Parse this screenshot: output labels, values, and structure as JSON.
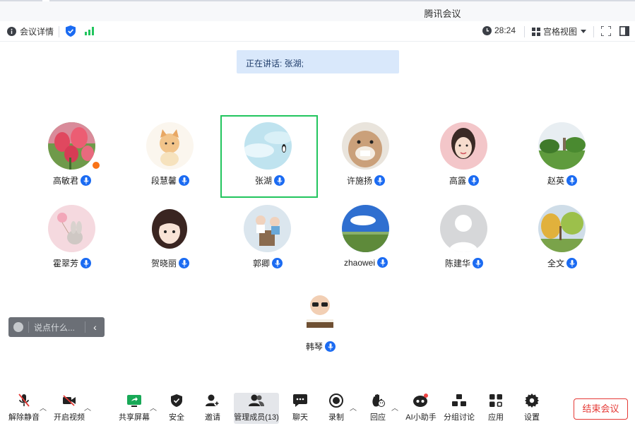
{
  "window": {
    "title": "腾讯会议"
  },
  "toolbar": {
    "meeting_details": "会议详情",
    "timer": "28:24",
    "view_mode": "宫格视图"
  },
  "banner": {
    "speaking": "正在讲话: 张湖;"
  },
  "participants": [
    {
      "name": "高敏君",
      "avatar": "pink-tulips"
    },
    {
      "name": "段慧馨",
      "avatar": "cartoon-cat"
    },
    {
      "name": "张湖",
      "avatar": "penguin-sky",
      "active": true
    },
    {
      "name": "许施扬",
      "avatar": "hamster"
    },
    {
      "name": "高露",
      "avatar": "woman-portrait"
    },
    {
      "name": "赵英",
      "avatar": "landscape-tree"
    },
    {
      "name": "霍翠芳",
      "avatar": "bunny-balloon"
    },
    {
      "name": "贺晓丽",
      "avatar": "anime-girl"
    },
    {
      "name": "郭卿",
      "avatar": "children-photo"
    },
    {
      "name": "zhaowei",
      "avatar": "blue-sky-field"
    },
    {
      "name": "陈建华",
      "avatar": "default-person"
    },
    {
      "name": "全文",
      "avatar": "autumn-trees"
    },
    {
      "name": "韩琴",
      "avatar": "baby-reading"
    }
  ],
  "chat": {
    "placeholder": "说点什么..."
  },
  "bottombar": {
    "unmute": "解除静音",
    "start_video": "开启视频",
    "share_screen": "共享屏幕",
    "security": "安全",
    "invite": "邀请",
    "manage_members": "管理成员(13)",
    "chat": "聊天",
    "record": "录制",
    "react": "回应",
    "ai_assistant": "AI小助手",
    "breakout": "分组讨论",
    "apps": "应用",
    "settings": "设置",
    "end_meeting": "结束会议"
  },
  "colors": {
    "accent_blue": "#1b6bf2",
    "active_border": "#22c55e",
    "end_red": "#e53935",
    "banner_bg": "#d9e8fb"
  }
}
